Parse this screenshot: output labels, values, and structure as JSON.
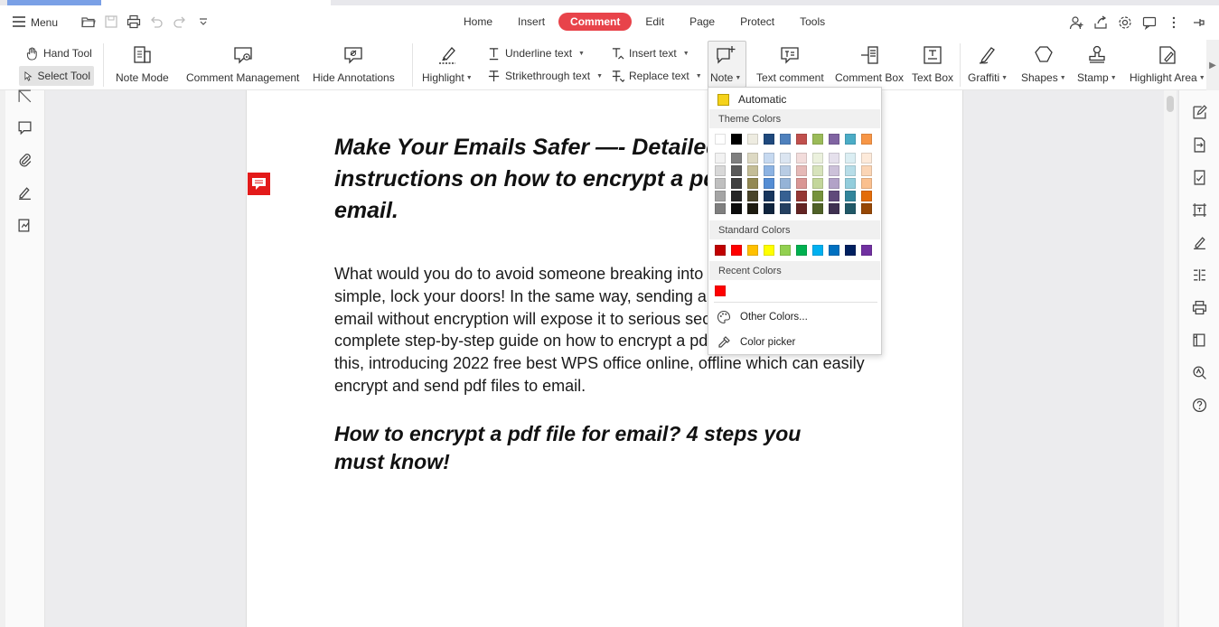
{
  "menu": {
    "label": "Menu"
  },
  "tabs": [
    "Home",
    "Insert",
    "Comment",
    "Edit",
    "Page",
    "Protect",
    "Tools"
  ],
  "active_tab": "Comment",
  "ribbon": {
    "hand_tool": "Hand Tool",
    "select_tool": "Select Tool",
    "note_mode": "Note Mode",
    "comment_management": "Comment Management",
    "hide_annotations": "Hide Annotations",
    "highlight": "Highlight",
    "underline_text": "Underline text",
    "strikethrough_text": "Strikethrough text",
    "insert_text": "Insert text",
    "replace_text": "Replace text",
    "note": "Note",
    "text_comment": "Text comment",
    "comment_box": "Comment Box",
    "text_box": "Text Box",
    "graffiti": "Graffiti",
    "shapes": "Shapes",
    "stamp": "Stamp",
    "highlight_area": "Highlight Area"
  },
  "document": {
    "heading1": "Make Your Emails Safer —- Detailed instructions on how to encrypt a pdf file for email.",
    "paragraph": "What would you do to avoid someone breaking into your house? Well, it's simple, lock your doors! In the same way, sending a pdf or any files in an email without encryption will expose it to serious security risks. Here is a complete step-by-step guide on how to encrypt a pdf file for email to do just this, introducing 2022 free best WPS office online, offline which can easily encrypt and send pdf files to email.",
    "heading2": "How to encrypt a pdf file for email? 4 steps you must know!"
  },
  "color_dropdown": {
    "automatic": "Automatic",
    "automatic_color": "#f5d21a",
    "theme_colors_label": "Theme Colors",
    "theme_top": [
      "#ffffff",
      "#000000",
      "#eeece1",
      "#1f497d",
      "#4f81bd",
      "#c0504d",
      "#9bbb59",
      "#8064a2",
      "#4bacc6",
      "#f79646"
    ],
    "theme_shades": [
      [
        "#f2f2f2",
        "#7f7f7f",
        "#ddd9c3",
        "#c6d9f0",
        "#dbe5f1",
        "#f2dcdb",
        "#ebf1dd",
        "#e5e0ec",
        "#dbeef3",
        "#fdeada"
      ],
      [
        "#d8d8d8",
        "#595959",
        "#c4bd97",
        "#8db3e2",
        "#b8cce4",
        "#e5b9b7",
        "#d7e3bc",
        "#ccc1d9",
        "#b7dde8",
        "#fbd5b5"
      ],
      [
        "#bfbfbf",
        "#3f3f3f",
        "#938953",
        "#548dd4",
        "#95b3d7",
        "#d99694",
        "#c3d69b",
        "#b2a2c7",
        "#92cddc",
        "#fac08f"
      ],
      [
        "#a5a5a5",
        "#262626",
        "#494429",
        "#17365d",
        "#366092",
        "#953734",
        "#76923c",
        "#5f497a",
        "#31859b",
        "#e36c09"
      ],
      [
        "#7f7f7f",
        "#0c0c0c",
        "#1d1b10",
        "#0f243e",
        "#244061",
        "#632423",
        "#4f6128",
        "#3f3151",
        "#205867",
        "#974806"
      ]
    ],
    "standard_colors_label": "Standard Colors",
    "standard_colors": [
      "#c00000",
      "#ff0000",
      "#ffc000",
      "#ffff00",
      "#92d050",
      "#00b050",
      "#00b0f0",
      "#0070c0",
      "#002060",
      "#7030a0"
    ],
    "recent_colors_label": "Recent Colors",
    "recent_colors": [
      "#ff0000"
    ],
    "other_colors": "Other Colors...",
    "color_picker": "Color picker"
  },
  "note_marker_color": "#e31a1a"
}
